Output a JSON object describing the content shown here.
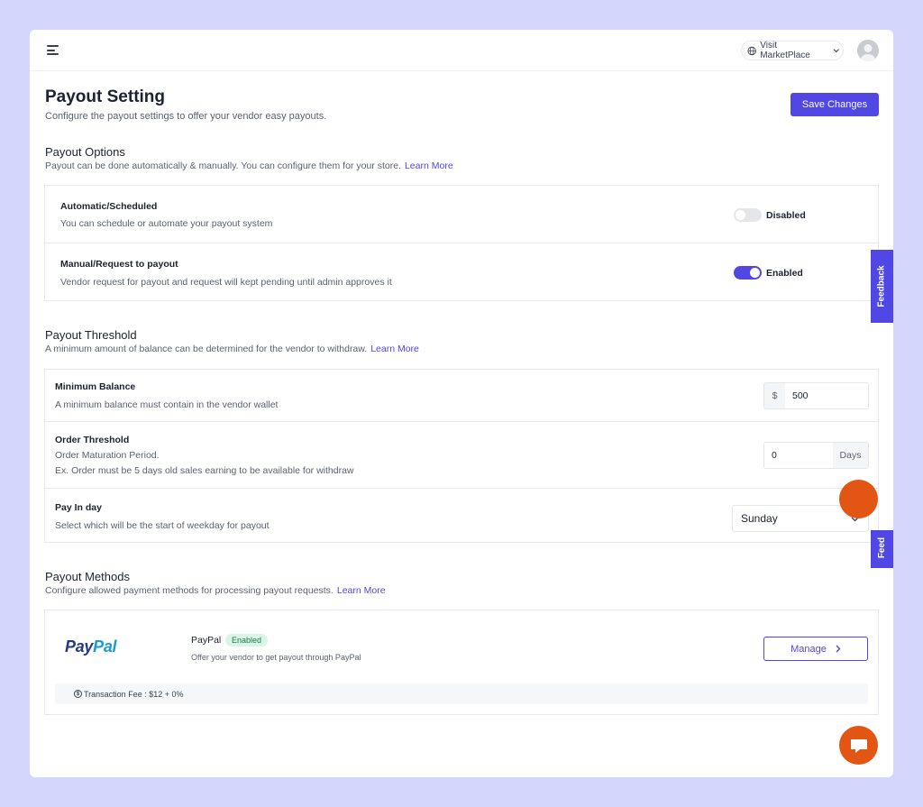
{
  "header": {
    "visit_label": "Visit MarketPlace"
  },
  "page": {
    "title": "Payout Setting",
    "subtitle": "Configure the payout settings to offer your vendor easy payouts.",
    "save_label": "Save Changes"
  },
  "payout_options": {
    "title": "Payout Options",
    "desc": "Payout can be done automatically & manually. You can configure them for your store.",
    "learn_more": "Learn More",
    "rows": [
      {
        "title": "Automatic/Scheduled",
        "desc": "You can schedule or automate your payout system",
        "state_label": "Disabled",
        "enabled": false
      },
      {
        "title": "Manual/Request to payout",
        "desc": "Vendor request for payout and request will kept pending until admin approves it",
        "state_label": "Enabled",
        "enabled": true
      }
    ]
  },
  "payout_threshold": {
    "title": "Payout Threshold",
    "desc": "A minimum amount of balance can be determined for the vendor to withdraw.",
    "learn_more": "Learn More",
    "minimum_balance": {
      "title": "Minimum Balance",
      "desc": "A minimum balance must contain in the vendor wallet",
      "currency": "$",
      "value": "500"
    },
    "order_threshold": {
      "title": "Order Threshold",
      "desc1": "Order Maturation Period.",
      "desc2": "Ex. Order must be 5 days old sales earning to be available for withdraw",
      "value": "0",
      "unit": "Days"
    },
    "pay_in_day": {
      "title": "Pay In day",
      "desc": "Select which will be the start of weekday for payout",
      "selected": "Sunday"
    }
  },
  "payout_methods": {
    "title": "Payout Methods",
    "desc": "Configure allowed payment methods for processing payout requests.",
    "learn_more": "Learn More",
    "paypal": {
      "logo_part1": "Pay",
      "logo_part2": "Pal",
      "name": "PayPal",
      "status": "Enabled",
      "desc": "Offer your vendor to get payout through PayPal",
      "manage_label": "Manage",
      "fee_label": "Transaction Fee : $12 + 0%"
    }
  },
  "feedback": {
    "label": "Feedback",
    "label_partial": "Feed"
  },
  "colors": {
    "accent": "#5047e5",
    "orange": "#e35512",
    "background": "#d5d6fc"
  }
}
